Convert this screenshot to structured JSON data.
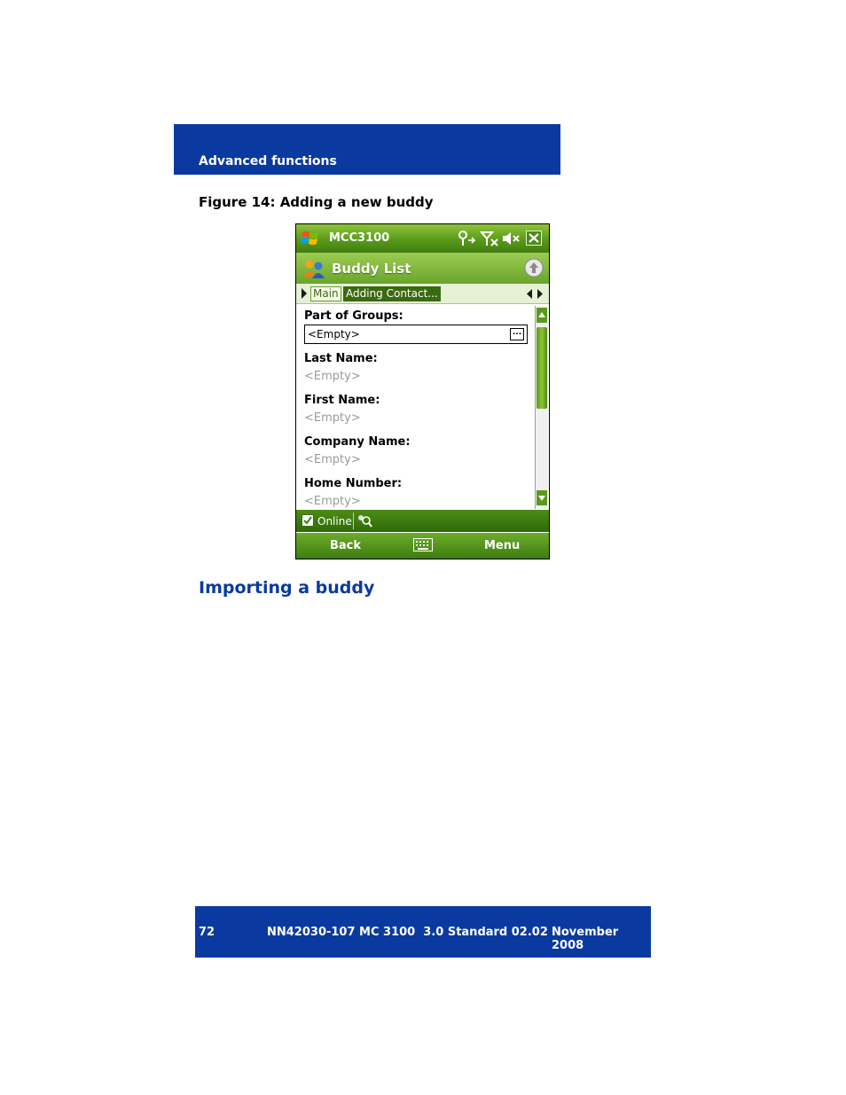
{
  "header": {
    "section": "Advanced functions"
  },
  "figure": {
    "caption": "Figure 14: Adding a new buddy"
  },
  "phone": {
    "title": "MCC3100",
    "app_title": "Buddy List",
    "tabs": [
      {
        "label": "Main"
      },
      {
        "label": "Adding Contact..."
      }
    ],
    "fields": [
      {
        "label": "Part of Groups:",
        "value": "<Empty>"
      },
      {
        "label": "Last Name:",
        "value": "<Empty>"
      },
      {
        "label": "First Name:",
        "value": "<Empty>"
      },
      {
        "label": "Company Name:",
        "value": "<Empty>"
      },
      {
        "label": "Home Number:",
        "value": "<Empty>"
      }
    ],
    "status": "Online",
    "softkeys": {
      "left": "Back",
      "right": "Menu"
    }
  },
  "section_heading": "Importing a buddy",
  "footer": {
    "page": "72",
    "doc": "NN42030-107 MC 3100  3.0 Standard 02.02",
    "date": "November 2008"
  }
}
